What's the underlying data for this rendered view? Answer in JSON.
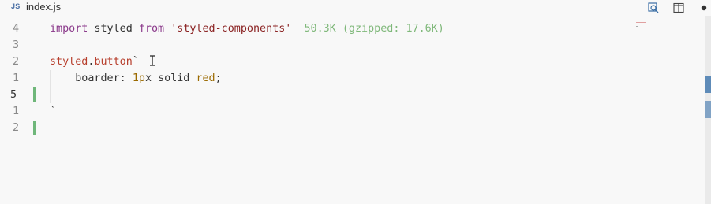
{
  "tab": {
    "lang_badge": "JS",
    "filename": "index.js"
  },
  "toolbar": {
    "icons": [
      "search-preview-icon",
      "split-editor-icon",
      "unsaved-dot-icon"
    ]
  },
  "editor": {
    "lines": [
      {
        "number": "4",
        "parts": [
          {
            "t": "import",
            "c": "kw"
          },
          {
            "t": " styled ",
            "c": ""
          },
          {
            "t": "from",
            "c": "kw"
          },
          {
            "t": " ",
            "c": ""
          },
          {
            "t": "'styled-components'",
            "c": "str"
          },
          {
            "t": "  50.3K (gzipped: 17.6K)",
            "c": "sizeinfo"
          }
        ]
      },
      {
        "number": "3",
        "parts": []
      },
      {
        "number": "2",
        "parts": [
          {
            "t": "styled",
            "c": "ident"
          },
          {
            "t": ".",
            "c": ""
          },
          {
            "t": "button",
            "c": "ident"
          },
          {
            "t": "`",
            "c": ""
          }
        ]
      },
      {
        "number": "1",
        "parts": [
          {
            "t": "    boarder: ",
            "c": ""
          },
          {
            "t": "1p",
            "c": "num"
          },
          {
            "t": "x solid ",
            "c": ""
          },
          {
            "t": "red",
            "c": "num"
          },
          {
            "t": ";",
            "c": ""
          }
        ]
      },
      {
        "number": "5",
        "parts": [],
        "active": true
      },
      {
        "number": "1",
        "parts": [
          {
            "t": "`",
            "c": ""
          }
        ]
      },
      {
        "number": "2",
        "parts": []
      }
    ]
  },
  "colors": {
    "background": "#f8f8f8",
    "gutter_modified": "#6fb77a",
    "scroll_marker": "#5e8bb8"
  }
}
